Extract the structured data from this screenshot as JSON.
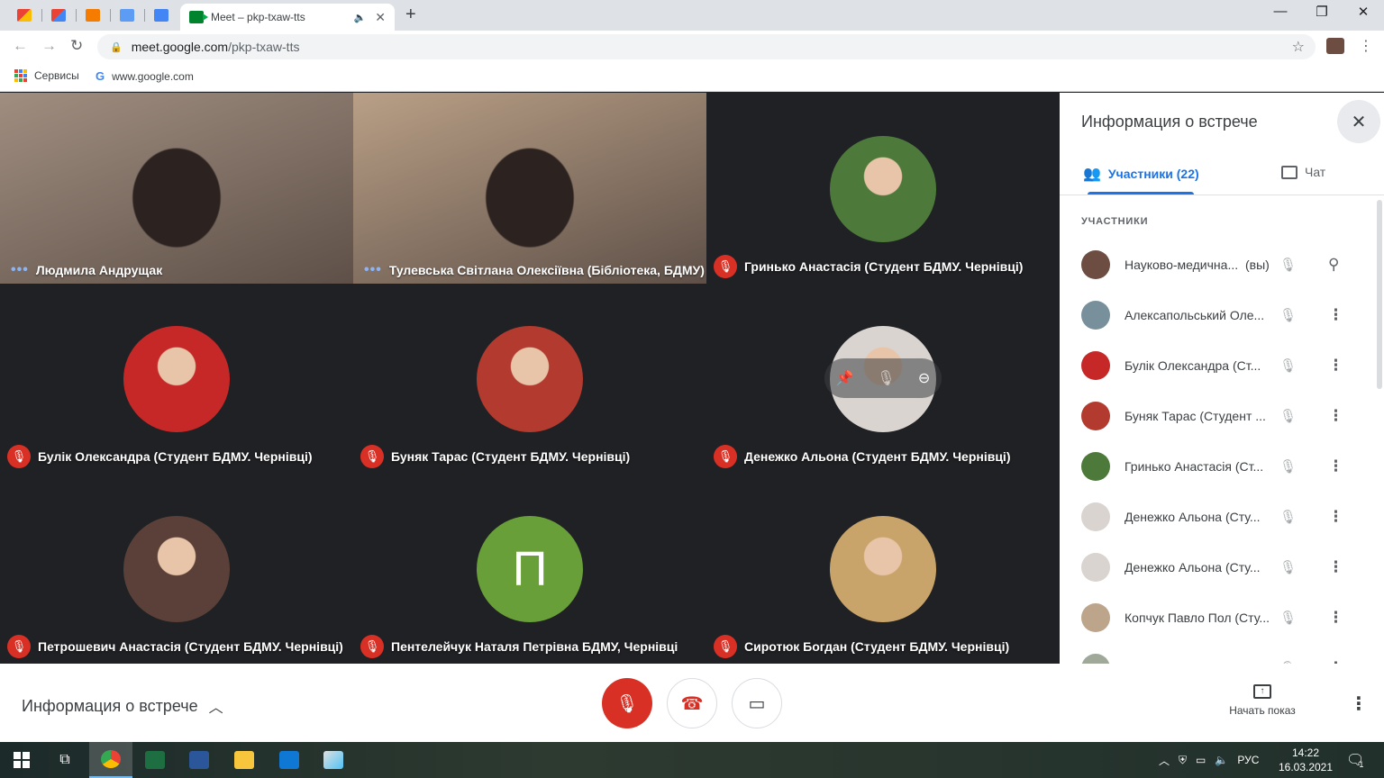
{
  "browser": {
    "active_tab_title": "Meet – pkp-txaw-tts",
    "url_host": "meet.google.com",
    "url_path": "/pkp-txaw-tts",
    "bookmarks": [
      {
        "label": "Сервисы",
        "icon": "apps-grid-icon"
      },
      {
        "label": "www.google.com",
        "icon": "google-icon"
      }
    ]
  },
  "grid": {
    "tiles": [
      {
        "name": "Людмила Андрущак",
        "status": "speaking",
        "kind": "video",
        "bg": "#a08e80"
      },
      {
        "name": "Тулевська Світлана Олексіївна (Бібліотека, БДМУ)",
        "status": "speaking",
        "kind": "video",
        "bg": "#b99f86"
      },
      {
        "name": "Гринько Анастасія (Студент БДМУ. Чернівці)",
        "status": "muted",
        "kind": "avatar",
        "bg": "#4d7a3a"
      },
      {
        "name": "Булік Олександра (Студент БДМУ. Чернівці)",
        "status": "muted",
        "kind": "avatar",
        "bg": "#c62828"
      },
      {
        "name": "Буняк Тарас (Студент БДМУ. Чернівці)",
        "status": "muted",
        "kind": "avatar",
        "bg": "#b23a2e"
      },
      {
        "name": "Денежко Альона (Студент БДМУ. Чернівці)",
        "status": "muted",
        "kind": "avatar",
        "bg": "#d9d4d0"
      },
      {
        "name": "Петрошевич Анастасія (Студент БДМУ. Чернівці)",
        "status": "muted",
        "kind": "avatar",
        "bg": "#5a4038"
      },
      {
        "name": "Пентелейчук Наталя Петрівна БДМУ, Чернівці",
        "status": "muted",
        "kind": "letter",
        "letter": "П",
        "bg": "#689f38"
      },
      {
        "name": "Сиротюк Богдан (Студент БДМУ. Чернівці)",
        "status": "muted",
        "kind": "avatar",
        "bg": "#c9a46a"
      }
    ]
  },
  "panel": {
    "title": "Информация о встрече",
    "tab_people": "Участники (22)",
    "tab_chat": "Чат",
    "section_label": "УЧАСТНИКИ",
    "participants": [
      {
        "name": "Науково-медична...",
        "tag": "(вы)",
        "action": "pin",
        "av": "#6d4c41"
      },
      {
        "name": "Алексапольський Оле...",
        "action": "more",
        "av": "#78909c"
      },
      {
        "name": "Булік Олександра (Ст...",
        "action": "more",
        "av": "#c62828"
      },
      {
        "name": "Буняк Тарас (Студент ...",
        "action": "more",
        "av": "#b23a2e"
      },
      {
        "name": "Гринько Анастасія (Ст...",
        "action": "more",
        "av": "#4d7a3a"
      },
      {
        "name": "Денежко Альона (Сту...",
        "action": "more",
        "av": "#d9d4d0"
      },
      {
        "name": "Денежко Альона (Сту...",
        "action": "more",
        "av": "#d9d4d0"
      },
      {
        "name": "Копчук Павло Пол (Сту...",
        "action": "more",
        "av": "#bca58a"
      },
      {
        "name": "",
        "action": "more",
        "av": "#a0a89a"
      }
    ]
  },
  "bottom": {
    "meeting_info": "Информация о встрече",
    "present_label": "Начать показ"
  },
  "taskbar": {
    "lang": "РУС",
    "time": "14:22",
    "date": "16.03.2021",
    "notif_count": "1"
  }
}
